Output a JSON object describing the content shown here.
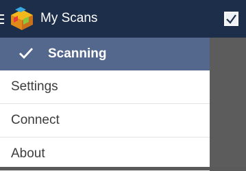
{
  "appbar": {
    "title": "My Scans",
    "menu_icon": "menu-icon",
    "logo_icon": "app-logo-icon",
    "action_icon": "checkbox-icon",
    "background": "#1d2e4a"
  },
  "drawer": {
    "items": [
      {
        "label": "Scanning",
        "active": true,
        "icon": "check-icon"
      },
      {
        "label": "Settings",
        "active": false
      },
      {
        "label": "Connect",
        "active": false
      },
      {
        "label": "About",
        "active": false
      }
    ],
    "active_color": "#54688d"
  }
}
